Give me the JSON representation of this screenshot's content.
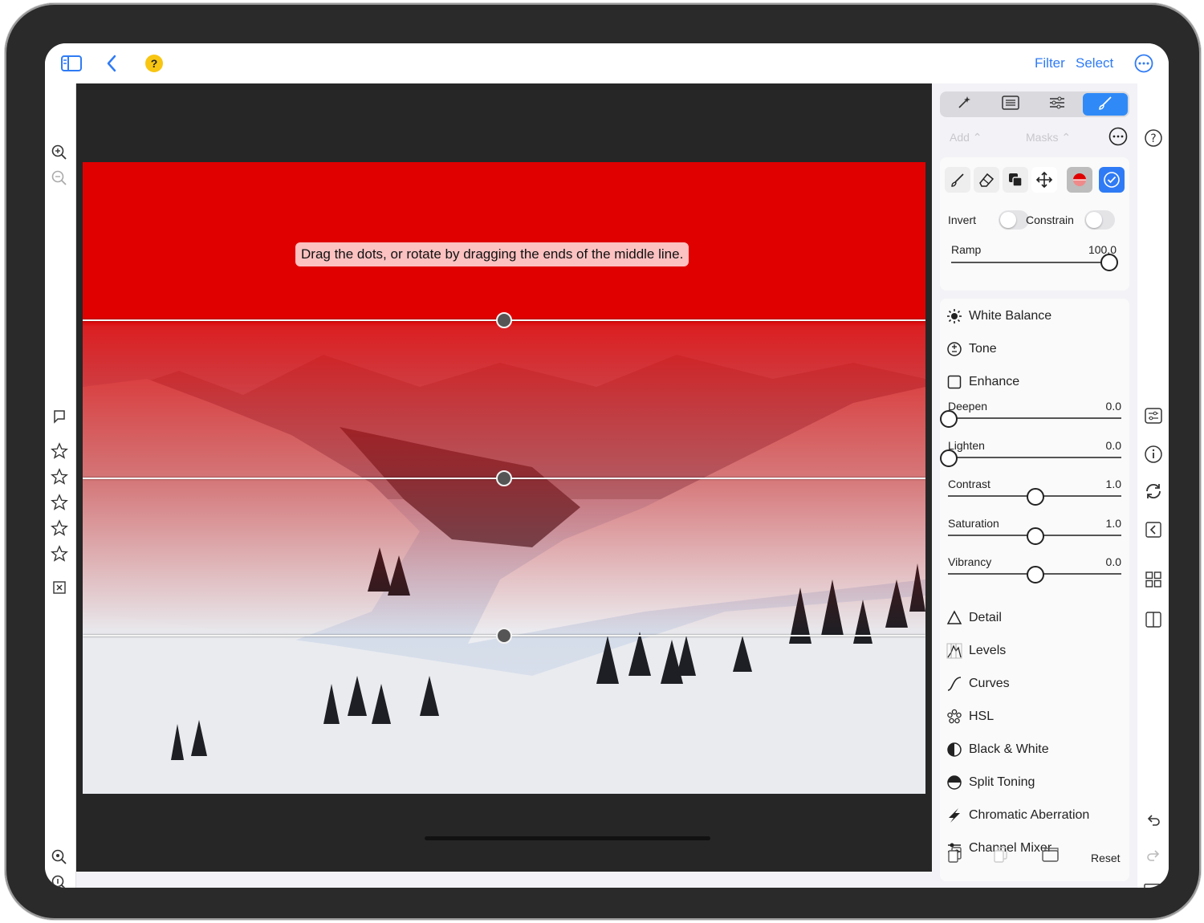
{
  "topbar": {
    "filter_label": "Filter",
    "select_label": "Select",
    "help_label": "?"
  },
  "canvas": {
    "hint": "Drag the dots, or rotate by dragging the ends of the middle line."
  },
  "panel": {
    "add_label": "Add ⌃",
    "masks_label": "Masks ⌃",
    "invert_label": "Invert",
    "constrain_label": "Constrain",
    "ramp_label": "Ramp",
    "ramp_value": "100.0",
    "ramp_fraction": 1.0,
    "adjustments": {
      "white_balance": "White Balance",
      "tone": "Tone",
      "enhance": "Enhance",
      "detail": "Detail",
      "levels": "Levels",
      "curves": "Curves",
      "hsl": "HSL",
      "bw": "Black & White",
      "split": "Split Toning",
      "chromatic": "Chromatic Aberration",
      "channel": "Channel Mixer"
    },
    "sliders": [
      {
        "label": "Deepen",
        "value": "0.0"
      },
      {
        "label": "Lighten",
        "value": "0.0"
      },
      {
        "label": "Contrast",
        "value": "1.0"
      },
      {
        "label": "Saturation",
        "value": "1.0"
      },
      {
        "label": "Vibrancy",
        "value": "0.0"
      }
    ],
    "reset_label": "Reset"
  },
  "colors": {
    "accent": "#2f7bf5",
    "mask_red": "#e00000",
    "canvas_bg": "#262626"
  }
}
